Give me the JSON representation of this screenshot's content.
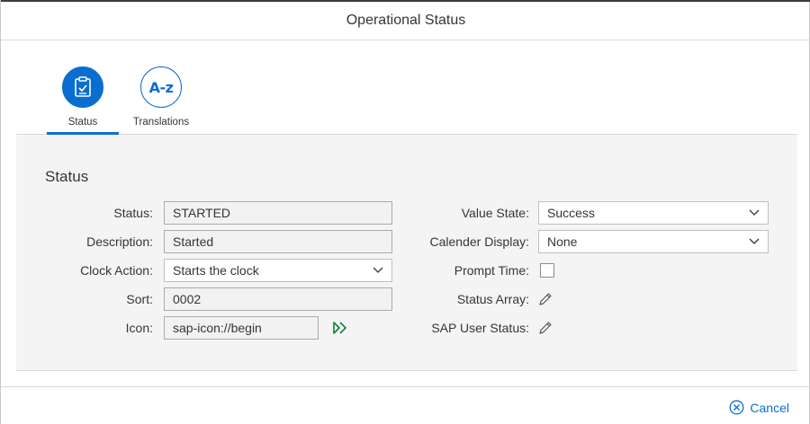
{
  "dialog": {
    "title": "Operational Status"
  },
  "tabs": [
    {
      "label": "Status",
      "icon": "clipboard-check-icon",
      "selected": true
    },
    {
      "label": "Translations",
      "icon": "a-z-icon",
      "icon_text": "A-z",
      "selected": false
    }
  ],
  "section": {
    "title": "Status"
  },
  "form": {
    "status": {
      "label": "Status:",
      "value": "STARTED"
    },
    "description": {
      "label": "Description:",
      "value": "Started"
    },
    "clock_action": {
      "label": "Clock Action:",
      "value": "Starts the clock"
    },
    "sort": {
      "label": "Sort:",
      "value": "0002"
    },
    "icon": {
      "label": "Icon:",
      "value": "sap-icon://begin",
      "preview_icon": "begin-icon"
    },
    "value_state": {
      "label": "Value State:",
      "value": "Success"
    },
    "calender_display": {
      "label": "Calender Display:",
      "value": "None"
    },
    "prompt_time": {
      "label": "Prompt Time:",
      "checked": false
    },
    "status_array": {
      "label": "Status Array:",
      "icon": "pencil-icon"
    },
    "sap_user_status": {
      "label": "SAP User Status:",
      "icon": "pencil-icon"
    }
  },
  "footer": {
    "cancel_label": "Cancel",
    "cancel_icon": "close-circle-icon"
  },
  "colors": {
    "accent": "#0a6ed1",
    "success_icon": "#107e3e",
    "content_bg": "#f4f4f4"
  }
}
